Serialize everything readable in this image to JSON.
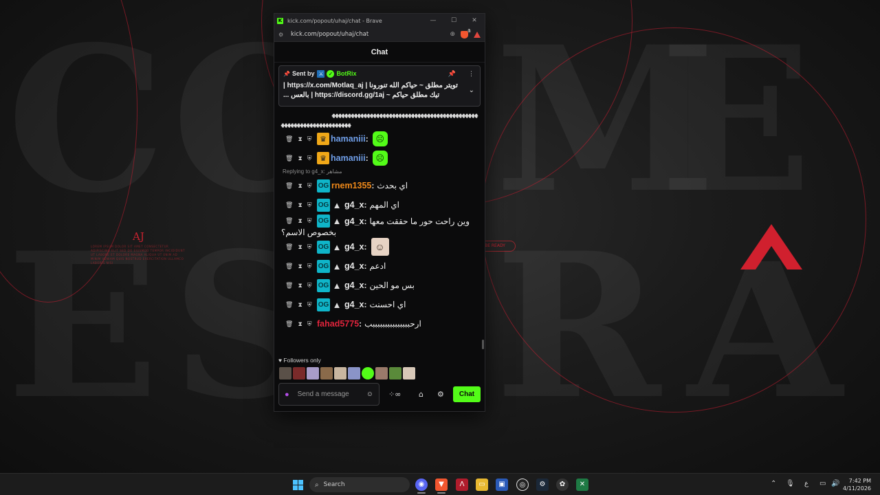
{
  "window": {
    "title": "kick.com/popout/uhaj/chat - Brave",
    "url": "kick.com/popout/uhaj/chat",
    "shield_count": "1"
  },
  "wallpaper": {
    "aj": "AJ",
    "small_text": "LOREM IPSUM DOLOR SIT AMET CONSECTETUR ADIPISCING ELIT SED DO EIUSMOD TEMPOR INCIDIDUNT UT LABORE ET DOLORE MAGNA ALIQUA UT ENIM AD MINIM VENIAM QUIS NOSTRUD EXERCITATION ULLAMCO LABORIS NISI",
    "ready": "BE READY"
  },
  "chat": {
    "header": "Chat",
    "pinned": {
      "sent_by": "Sent by",
      "bot_name": "BotRix",
      "text": "تويتر مطلق ~ حياكم الله تنورونا | https://x.com/Motlaq_aj | تيك مطلق حياكم ~ https://discord.gg/1aj | بالعس ..."
    },
    "overflow_line_1": "ﻬﻬﻬﻬﻬﻬﻬﻬﻬﻬﻬﻬﻬﻬﻬﻬﻬﻬﻬﻬﻬﻬﻬﻬﻬﻬﻬﻬﻬﻬﻬﻬﻬﻬﻬﻬﻬﻬﻬﻬﻬﻬﻬﻬﻬﻬ",
    "overflow_line_2": "ﻬﻬﻬﻬﻬﻬﻬﻬﻬﻬﻬﻬﻬﻬﻬﻬﻬﻬﻬﻬﻬﻬ",
    "messages": [
      {
        "user": "hamaniii",
        "color": "#6f9ee8",
        "text": ""
      },
      {
        "user": "hamaniii",
        "color": "#6f9ee8",
        "text": ""
      },
      {
        "reply": "Replying to g4_x: مشاهر",
        "user": "rnem1355",
        "color": "#f08a1a",
        "text": "اي بحدث"
      },
      {
        "user": "g4_x",
        "color": "#e8e8e8",
        "text": "اي المهم"
      },
      {
        "user": "g4_x",
        "color": "#e8e8e8",
        "text": "وين راحت حور ما حققت معها",
        "text2": "بخصوص الاسم؟"
      },
      {
        "user": "g4_x",
        "color": "#e8e8e8",
        "text": ""
      },
      {
        "user": "g4_x",
        "color": "#e8e8e8",
        "text": "ادعم"
      },
      {
        "user": "g4_x",
        "color": "#e8e8e8",
        "text": "بس مو الحين"
      },
      {
        "user": "g4_x",
        "color": "#e8e8e8",
        "text": "اي احسنت"
      },
      {
        "user": "fahad5775",
        "color": "#e0243c",
        "text": "ارحبببببببببببببببب"
      }
    ],
    "followers_only": "Followers only",
    "composer_placeholder": "Send a message",
    "send_label": "Chat",
    "accent": "#53fc18"
  },
  "taskbar": {
    "search_placeholder": "Search",
    "lang": "ع",
    "time": "7:42 PM",
    "date": "4/11/2026"
  }
}
